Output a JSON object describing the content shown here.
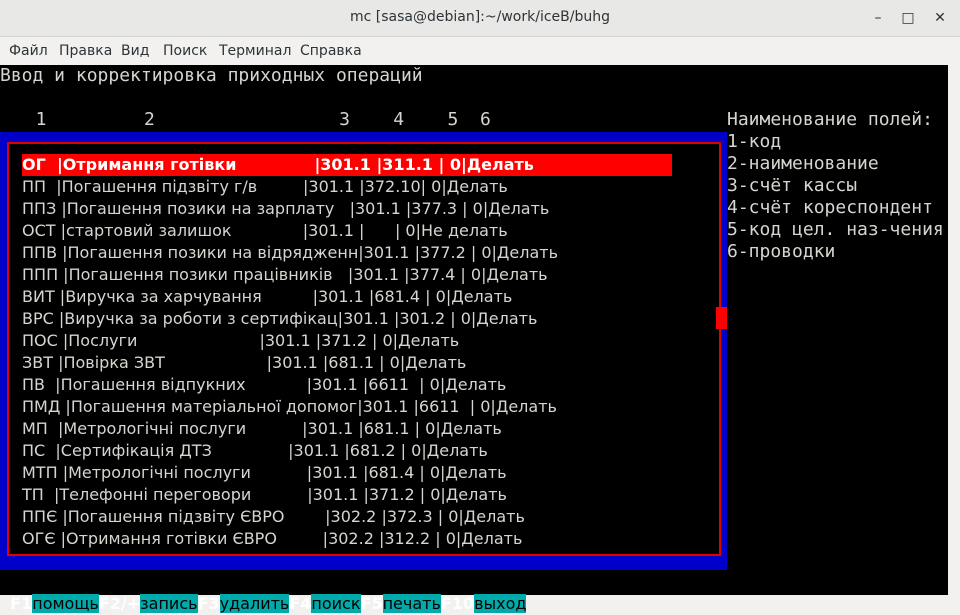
{
  "window": {
    "title": "mc [sasa@debian]:~/work/iceB/buhg",
    "minimize": "–",
    "maximize": "□",
    "close": "✕"
  },
  "menu": [
    "Файл",
    "Правка",
    "Вид",
    "Поиск",
    "Терминал",
    "Справка"
  ],
  "terminal": {
    "heading": "Ввод и корректировка приходных операций",
    "col_numbers": "  1         2                 3    4    5  6",
    "legend_title": "Наименование полей:",
    "legend": [
      "1-код",
      "2-наименование",
      "3-счёт кассы",
      "4-счёт кореспондент",
      "5-код цел. наз-чения",
      "6-проводки"
    ],
    "rows": [
      "ОГ  |Отримання готівки              |301.1 |311.1 | 0|Делать",
      "ПП  |Погашення підзвіту г/в         |301.1 |372.10| 0|Делать",
      "ППЗ |Погашення позики на зарплату   |301.1 |377.3 | 0|Делать",
      "ОСТ |стартовий залишок              |301.1 |      | 0|Не делать",
      "ППВ |Погашення позики на відрядженн|301.1 |377.2 | 0|Делать",
      "ППП |Погашення позики працівників   |301.1 |377.4 | 0|Делать",
      "ВИТ |Виручка за харчування          |301.1 |681.4 | 0|Делать",
      "ВРС |Виручка за роботи з сертифікац|301.1 |301.2 | 0|Делать",
      "ПОС |Послуги                        |301.1 |371.2 | 0|Делать",
      "ЗВТ |Повірка ЗВТ                    |301.1 |681.1 | 0|Делать",
      "ПВ  |Погашення відпукних            |301.1 |6611  | 0|Делать",
      "ПМД |Погашення матеріальної допомог|301.1 |6611  | 0|Делать",
      "МП  |Метрологічні послуги           |301.1 |681.1 | 0|Делать",
      "ПС  |Сертифікація ДТЗ               |301.1 |681.2 | 0|Делать",
      "МТП |Метрологічні послуги           |301.1 |681.4 | 0|Делать",
      "ТП  |Телефонні переговори           |301.1 |371.2 | 0|Делать",
      "ППЄ |Погашення підзвіту ЄВРО        |302.2 |372.3 | 0|Делать",
      "ОГЄ |Отримання готівки ЄВРО         |302.2 |312.2 | 0|Делать"
    ],
    "fkeys": [
      {
        "key": "F1",
        "label": "помощь"
      },
      {
        "key": "F2/+",
        "label": "запись"
      },
      {
        "key": "F3",
        "label": "удалить"
      },
      {
        "key": "F4",
        "label": "поиск"
      },
      {
        "key": "F5",
        "label": "печать"
      },
      {
        "key": "F10",
        "label": "выход"
      }
    ]
  },
  "colors": {
    "panel_bg": "#0000c8",
    "selection": "#ff0000",
    "fkey_label_bg": "#00aaaa"
  }
}
